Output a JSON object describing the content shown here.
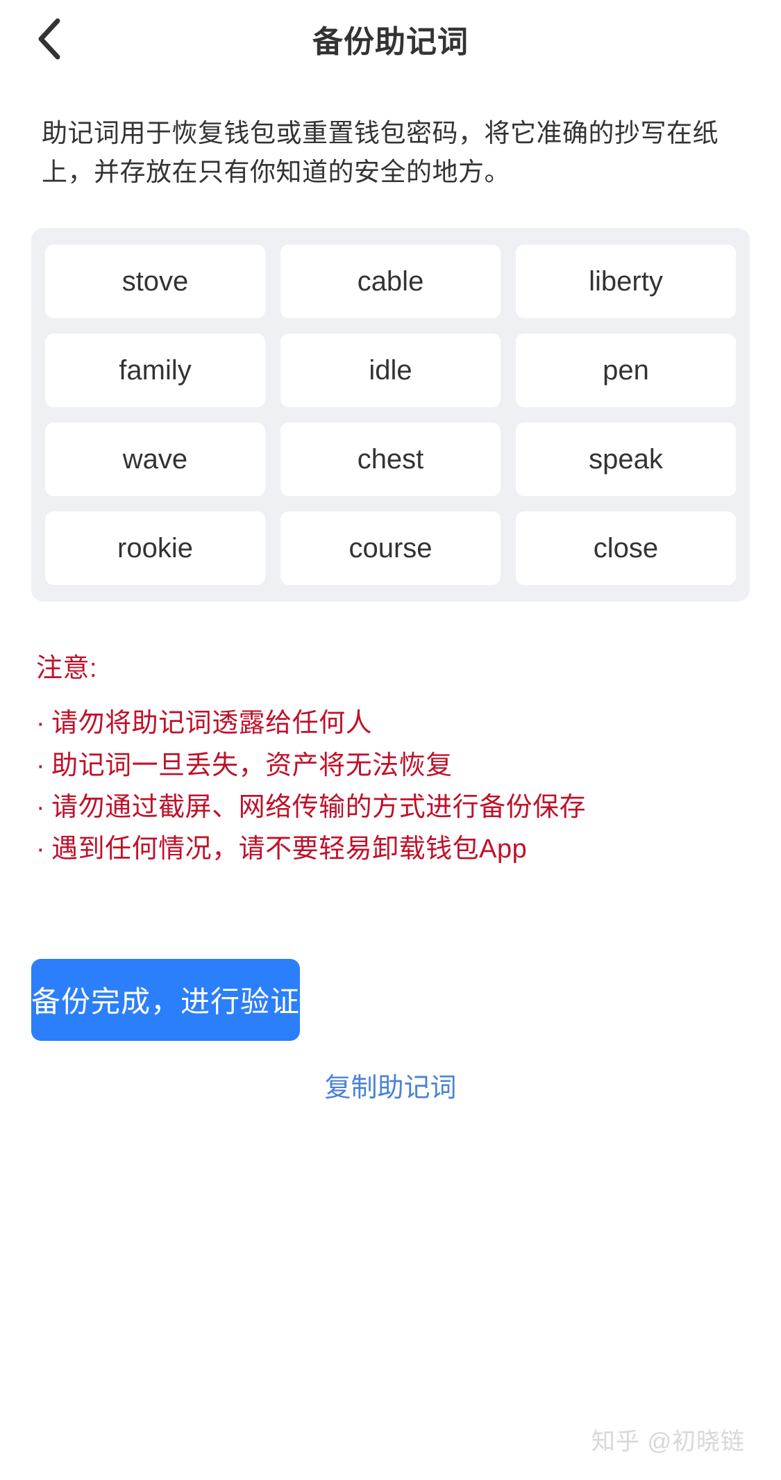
{
  "header": {
    "title": "备份助记词",
    "back_icon": "chevron-left-icon"
  },
  "description": "助记词用于恢复钱包或重置钱包密码，将它准确的抄写在纸上，并存放在只有你知道的安全的地方。",
  "mnemonic": {
    "words": [
      "stove",
      "cable",
      "liberty",
      "family",
      "idle",
      "pen",
      "wave",
      "chest",
      "speak",
      "rookie",
      "course",
      "close"
    ]
  },
  "warning": {
    "title": "注意:",
    "bullet": "·",
    "items": [
      "请勿将助记词透露给任何人",
      "助记词一旦丢失，资产将无法恢复",
      "请勿通过截屏、网络传输的方式进行备份保存",
      "遇到任何情况，请不要轻易卸载钱包App"
    ]
  },
  "actions": {
    "primary_label": "备份完成，进行验证",
    "copy_label": "复制助记词"
  },
  "watermark": "知乎 @初晓链",
  "colors": {
    "primary": "#2b7ffa",
    "warning": "#c0112a",
    "link": "#4a82d6",
    "card_bg": "#ffffff",
    "grid_bg": "#eff0f4",
    "text": "#333333"
  }
}
